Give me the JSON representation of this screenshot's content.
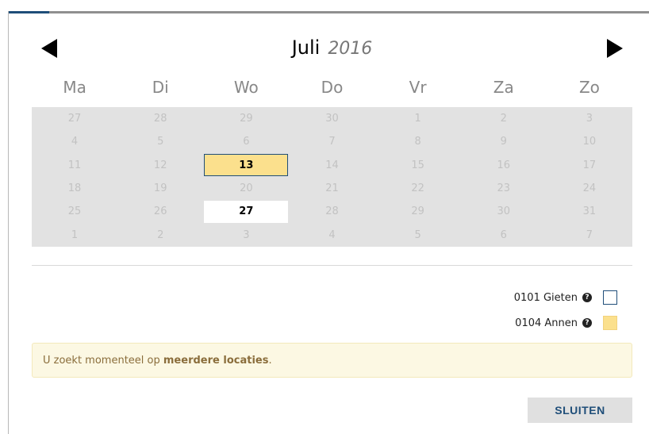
{
  "header": {
    "month": "Juli",
    "year": "2016",
    "prev_icon": "triangle-left-icon",
    "next_icon": "triangle-right-icon"
  },
  "weekdays": [
    "Ma",
    "Di",
    "Wo",
    "Do",
    "Vr",
    "Za",
    "Zo"
  ],
  "weeks": [
    [
      "27",
      "28",
      "29",
      "30",
      "1",
      "2",
      "3"
    ],
    [
      "4",
      "5",
      "6",
      "7",
      "8",
      "9",
      "10"
    ],
    [
      "11",
      "12",
      "13",
      "14",
      "15",
      "16",
      "17"
    ],
    [
      "18",
      "19",
      "20",
      "21",
      "22",
      "23",
      "24"
    ],
    [
      "25",
      "26",
      "27",
      "28",
      "29",
      "30",
      "31"
    ],
    [
      "1",
      "2",
      "3",
      "4",
      "5",
      "6",
      "7"
    ]
  ],
  "highlighted_days": [
    {
      "week": 2,
      "day": 2,
      "style": "yellow"
    },
    {
      "week": 4,
      "day": 2,
      "style": "white"
    }
  ],
  "legend": [
    {
      "label": "0101 Gieten",
      "help_icon": "question-circle-icon",
      "swatch_color": "#ffffff",
      "swatch_border": "#1f4e79"
    },
    {
      "label": "0104 Annen",
      "help_icon": "question-circle-icon",
      "swatch_color": "#fbe08d",
      "swatch_border": "#f2d27d"
    }
  ],
  "notice": {
    "prefix": "U zoekt momenteel op ",
    "bold": "meerdere locaties",
    "suffix": "."
  },
  "close_label": "SLUITEN",
  "colors": {
    "accent": "#1f4e79",
    "highlight": "#fbe08d",
    "grid_bg": "#e2e2e2",
    "notice_bg": "#fcf8e3"
  }
}
